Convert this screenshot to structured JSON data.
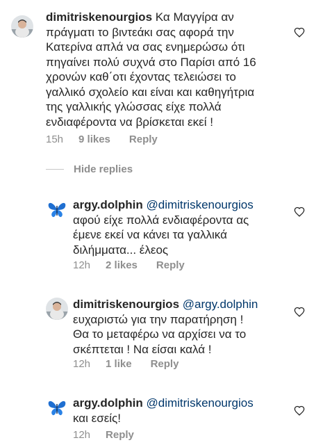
{
  "comments": [
    {
      "username": "dimitriskenourgios",
      "mention": "",
      "text": "Κα Μαγγίρα αν\nπράγματι το βιντεάκι σας αφορά την\nΚατερίνα απλά να σας ενημερώσω ότι\nπηγαίνει πολύ συχνά στο Παρίσι από 16\nχρονών καθ΄οτι έχοντας τελειώσει το\nγαλλικό σχολείο και είναι και καθηγήτρια\nτης γαλλικής γλώσσας είχε πολλά\nενδιαφέροντα να βρίσκεται εκεί !",
      "time": "15h",
      "likes": "9 likes",
      "reply": "Reply",
      "avatar_icon": "profile-photo-man"
    },
    {
      "username": "argy.dolphin",
      "mention": "@dimitriskenourgios",
      "text": "αφού είχε πολλά ενδιαφέροντα ας\nέμενε εκεί να κάνει τα γαλλικά\nδιλήμματα... έλεος",
      "time": "12h",
      "likes": "2 likes",
      "reply": "Reply",
      "avatar_icon": "blue-butterfly"
    },
    {
      "username": "dimitriskenourgios",
      "mention": "@argy.dolphin",
      "text": "ευχαριστώ για την παρατήρηση !\nΘα το μεταφέρω να αρχίσει να το\nσκέπτεται ! Να είσαι καλά !",
      "time": "12h",
      "likes": "1 like",
      "reply": "Reply",
      "avatar_icon": "profile-photo-man"
    },
    {
      "username": "argy.dolphin",
      "mention": "@dimitriskenourgios",
      "text": "και εσείς!",
      "time": "12h",
      "likes": "",
      "reply": "Reply",
      "avatar_icon": "blue-butterfly"
    }
  ],
  "hide_replies_label": "Hide replies",
  "like_icon": "heart-outline-icon",
  "colors": {
    "text": "#262626",
    "meta": "#8e8e8e",
    "mention": "#00376b",
    "butterfly": "#1f6fd1"
  }
}
